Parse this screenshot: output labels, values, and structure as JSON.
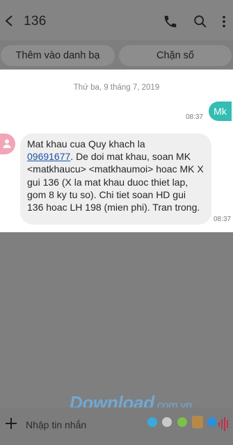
{
  "header": {
    "title": "136"
  },
  "actions": {
    "add_contact": "Thêm vào danh bạ",
    "block": "Chặn số"
  },
  "conversation": {
    "date": "Thứ ba, 9 tháng 7, 2019",
    "outgoing": {
      "text": "Mk",
      "time": "08:37"
    },
    "incoming": {
      "line1": "Mat khau cua Quy khach la",
      "code": "09691677",
      "rest": ". De doi mat khau, soan MK <matkhaucu> <matkhaumoi> hoac MK X gui 136 (X la mat khau duoc thiet lap, gom 8 ky tu so). Chi tiet soan HD gui 136 hoac LH 198 (mien phi). Tran trong.",
      "time": "08:37"
    }
  },
  "compose": {
    "placeholder": "Nhập tin nhắn"
  },
  "watermark": {
    "brand": "Download",
    "domain": ".com.vn"
  },
  "colors": {
    "accent": "#33bdb3",
    "avatar": "#f2a5b6",
    "link": "#1a4fa8"
  }
}
